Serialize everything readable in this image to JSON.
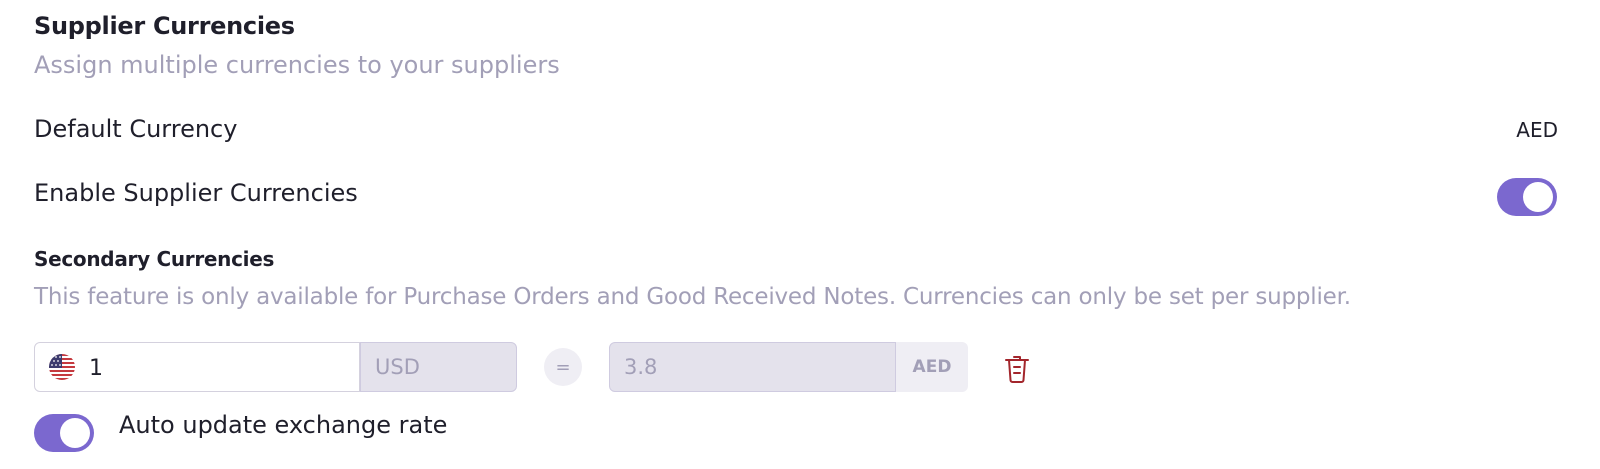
{
  "header": {
    "title": "Supplier Currencies",
    "subtitle": "Assign multiple currencies to your suppliers"
  },
  "default_currency": {
    "label": "Default Currency",
    "value": "AED"
  },
  "enable_supplier_currencies": {
    "label": "Enable Supplier Currencies",
    "enabled": true
  },
  "secondary": {
    "title": "Secondary Currencies",
    "description": "This feature is only available for Purchase Orders and Good Received Notes. Currencies can only be set per supplier."
  },
  "currency_row": {
    "flag": "us-flag-icon",
    "amount": "1",
    "currency": "USD",
    "equals": "=",
    "rate": "3.8",
    "rate_unit": "AED",
    "delete_icon": "trash-icon"
  },
  "auto_update": {
    "label": "Auto update exchange rate",
    "enabled": true
  },
  "colors": {
    "accent": "#7b68cf",
    "muted_text": "#a29fb7",
    "danger": "#a3262c"
  }
}
